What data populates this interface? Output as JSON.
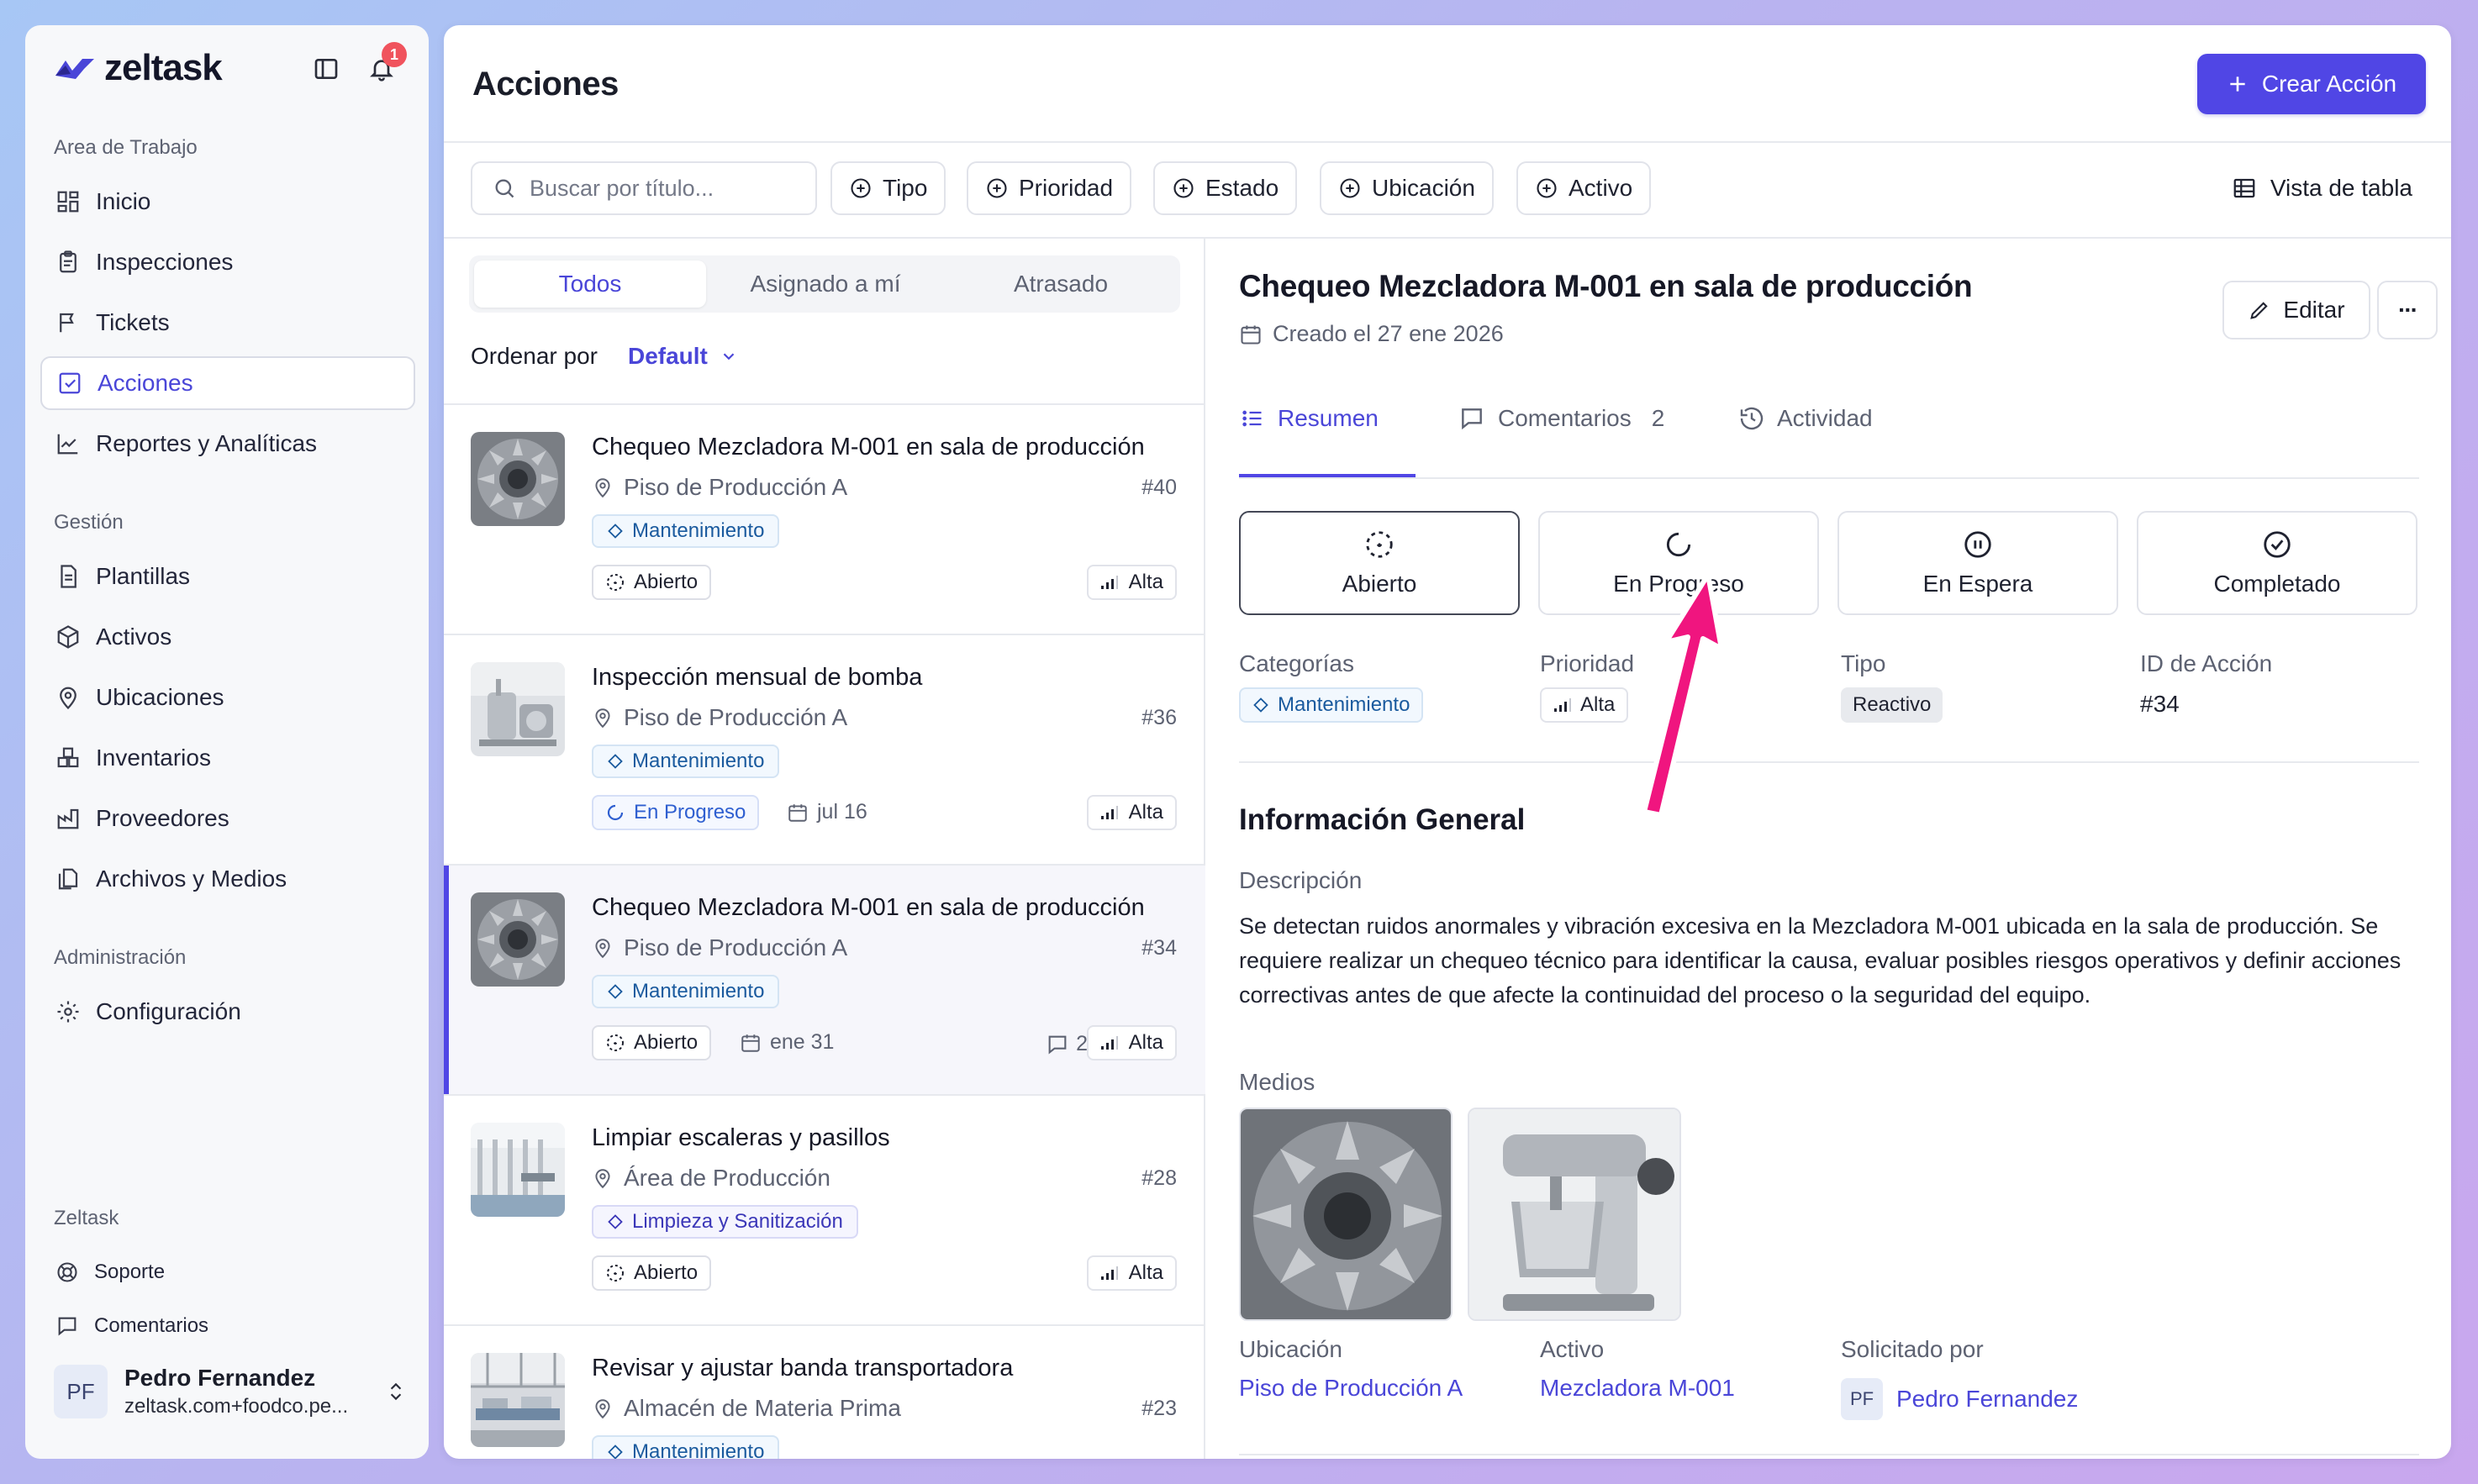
{
  "sidebar": {
    "logo": "zeltask",
    "notifications_count": "1",
    "sections": {
      "workspace": "Area de Trabajo",
      "management": "Gestión",
      "admin": "Administración",
      "footer": "Zeltask"
    },
    "items": {
      "home": "Inicio",
      "inspections": "Inspecciones",
      "tickets": "Tickets",
      "actions": "Acciones",
      "reports": "Reportes y Analíticas",
      "templates": "Plantillas",
      "assets": "Activos",
      "locations": "Ubicaciones",
      "inventories": "Inventarios",
      "suppliers": "Proveedores",
      "files": "Archivos y Medios",
      "settings": "Configuración",
      "support": "Soporte",
      "feedback": "Comentarios"
    },
    "user": {
      "initials": "PF",
      "name": "Pedro Fernandez",
      "email": "zeltask.com+foodco.pe..."
    }
  },
  "header": {
    "title": "Acciones",
    "create_label": "Crear Acción"
  },
  "toolbar": {
    "search_placeholder": "Buscar por título...",
    "filters": [
      "Tipo",
      "Prioridad",
      "Estado",
      "Ubicación",
      "Activo"
    ],
    "view_label": "Vista de tabla"
  },
  "list": {
    "tabs": [
      "Todos",
      "Asignado a mí",
      "Atrasado"
    ],
    "sort_label": "Ordenar por",
    "sort_value": "Default",
    "cards": [
      {
        "title": "Chequeo Mezcladora M-001 en sala de producción",
        "location": "Piso de Producción A",
        "number": "#40",
        "category": "Mantenimiento",
        "status": "Abierto",
        "due": "",
        "comments": "",
        "priority": "Alta"
      },
      {
        "title": "Inspección mensual de bomba",
        "location": "Piso de Producción A",
        "number": "#36",
        "category": "Mantenimiento",
        "status": "En Progreso",
        "due": "jul 16",
        "comments": "",
        "priority": "Alta"
      },
      {
        "title": "Chequeo Mezcladora M-001 en sala de producción",
        "location": "Piso de Producción A",
        "number": "#34",
        "category": "Mantenimiento",
        "status": "Abierto",
        "due": "ene 31",
        "comments": "2",
        "priority": "Alta"
      },
      {
        "title": "Limpiar escaleras y pasillos",
        "location": "Área de Producción",
        "number": "#28",
        "category": "Limpieza y Sanitización",
        "status": "Abierto",
        "due": "",
        "comments": "",
        "priority": "Alta"
      },
      {
        "title": "Revisar y ajustar banda transportadora",
        "location": "Almacén de Materia Prima",
        "number": "#23",
        "category": "Mantenimiento",
        "status": "",
        "due": "",
        "comments": "",
        "priority": ""
      }
    ]
  },
  "detail": {
    "title": "Chequeo Mezcladora M-001 en sala de producción",
    "created": "Creado el 27 ene 2026",
    "edit_label": "Editar",
    "more_label": "···",
    "tabs": {
      "summary": "Resumen",
      "comments": "Comentarios",
      "comments_count": "2",
      "activity": "Actividad"
    },
    "statuses": [
      "Abierto",
      "En Progreso",
      "En Espera",
      "Completado"
    ],
    "fields": {
      "categories_label": "Categorías",
      "categories_value": "Mantenimiento",
      "priority_label": "Prioridad",
      "priority_value": "Alta",
      "type_label": "Tipo",
      "type_value": "Reactivo",
      "id_label": "ID de Acción",
      "id_value": "#34"
    },
    "general_title": "Información General",
    "description_label": "Descripción",
    "description": "Se detectan ruidos anormales y vibración excesiva en la Mezcladora M-001 ubicada en la sala de producción. Se requiere realizar un chequeo técnico para identificar la causa, evaluar posibles riesgos operativos y definir acciones correctivas antes de que afecte la continuidad del proceso o la seguridad del equipo.",
    "media_label": "Medios",
    "location_label": "Ubicación",
    "location_value": "Piso de Producción A",
    "asset_label": "Activo",
    "asset_value": "Mezcladora M-001",
    "requested_label": "Solicitado por",
    "requested_initials": "PF",
    "requested_value": "Pedro Fernandez"
  },
  "colors": {
    "accent": "#5046e5",
    "annotation_arrow": "#f0157f",
    "badge_red": "#f0535d"
  }
}
